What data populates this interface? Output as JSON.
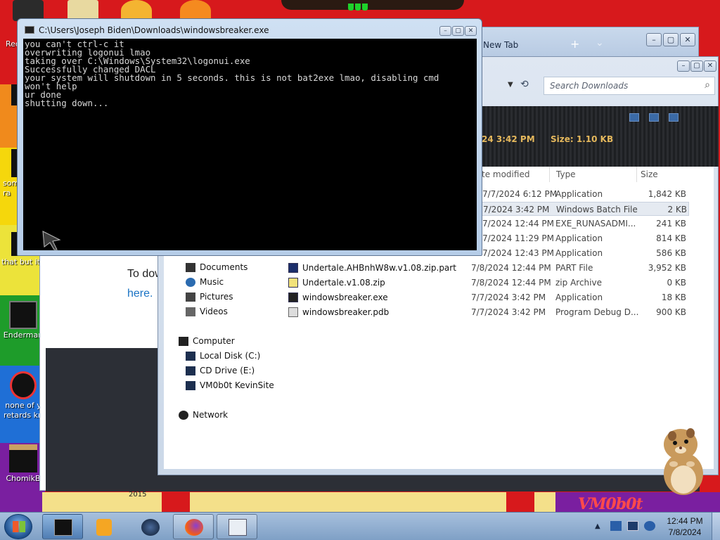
{
  "console": {
    "title": "C:\\Users\\Joseph Biden\\Downloads\\windowsbreaker.exe",
    "lines": [
      "you can't ctrl-c it",
      "overwriting logonui lmao",
      "taking over C:\\Windows\\System32\\logonui.exe",
      "Successfully changed DACL",
      "your system will shutdown in 5 seconds. this is not bat2exe lmao, disabling cmd",
      "won't help",
      "ur done",
      "shutting down..."
    ]
  },
  "browser": {
    "tab_label": "New Tab",
    "body_text": "To dow",
    "link_text": "here."
  },
  "explorer": {
    "search_placeholder": "Search Downloads",
    "info_date": "24 3:42 PM",
    "info_size": "Size: 1.10 KB",
    "columns": {
      "date": "te modified",
      "type": "Type",
      "size": "Size"
    },
    "partial_rows": [
      {
        "date": "7/7/2024 6:12 PM",
        "type": "Application",
        "size": "1,842 KB"
      },
      {
        "date": "7/2024 3:42 PM",
        "type": "Windows Batch File",
        "size": "2 KB"
      },
      {
        "date": "7/2024 12:44 PM",
        "type": "EXE_RUNASADMI...",
        "size": "241 KB"
      },
      {
        "date": "7/2024 11:29 PM",
        "type": "Application",
        "size": "814 KB"
      },
      {
        "date": "7/2024 12:43 PM",
        "type": "Application",
        "size": "586 KB"
      }
    ],
    "files": [
      {
        "name": "Undertale.AHBnhW8w.v1.08.zip.part",
        "date": "7/8/2024 12:44 PM",
        "type": "PART File",
        "size": "3,952 KB"
      },
      {
        "name": "Undertale.v1.08.zip",
        "date": "7/8/2024 12:44 PM",
        "type": "zip Archive",
        "size": "0 KB"
      },
      {
        "name": "windowsbreaker.exe",
        "date": "7/7/2024 3:42 PM",
        "type": "Application",
        "size": "18 KB"
      },
      {
        "name": "windowsbreaker.pdb",
        "date": "7/7/2024 3:42 PM",
        "type": "Program Debug D...",
        "size": "900 KB"
      }
    ],
    "nav": {
      "documents": "Documents",
      "music": "Music",
      "pictures": "Pictures",
      "videos": "Videos",
      "computer": "Computer",
      "local_disk": "Local Disk (C:)",
      "cd_drive": "CD Drive (E:)",
      "vmshare": "VM0b0t KevinSite",
      "network": "Network"
    }
  },
  "desktop": {
    "icons": [
      {
        "label": "Rec"
      },
      {
        "label": "som ra"
      },
      {
        "label": "that but it"
      },
      {
        "label": "Enderman"
      },
      {
        "label": "none of y retards kn"
      },
      {
        "label": "ChomikB"
      }
    ],
    "wallpaper_year": "2015",
    "wallpaper_logo": "VM0b0t"
  },
  "taskbar": {
    "time": "12:44 PM",
    "date": "7/8/2024"
  },
  "colors": {
    "desktop_red": "#d7191c",
    "console_bg": "#000000",
    "console_text": "#d8d8d8",
    "explorer_info_text": "#e5b85c",
    "link_blue": "#1a73c4"
  }
}
